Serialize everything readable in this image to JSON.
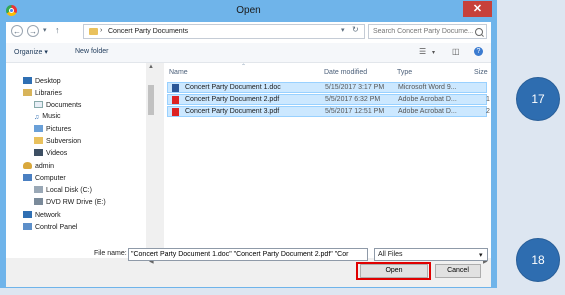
{
  "window": {
    "title": "Open",
    "close_glyph": "✕"
  },
  "address": {
    "path": "Concert Party Documents",
    "search_placeholder": "Search Concert Party Docume..."
  },
  "toolbar": {
    "organize_label": "Organize ▾",
    "new_folder_label": "New folder"
  },
  "nav": {
    "items": [
      {
        "label": "Desktop",
        "icon": "desktop-icon"
      },
      {
        "label": "Libraries",
        "icon": "library-icon"
      },
      {
        "label": "Documents",
        "icon": "documents-icon"
      },
      {
        "label": "Music",
        "icon": "music-icon"
      },
      {
        "label": "Pictures",
        "icon": "pictures-icon"
      },
      {
        "label": "Subversion",
        "icon": "folder-icon"
      },
      {
        "label": "Videos",
        "icon": "videos-icon"
      },
      {
        "label": "admin",
        "icon": "user-icon"
      },
      {
        "label": "Computer",
        "icon": "computer-icon"
      },
      {
        "label": "Local Disk (C:)",
        "icon": "drive-icon"
      },
      {
        "label": "DVD RW Drive (E:)",
        "icon": "dvd-icon"
      },
      {
        "label": "Network",
        "icon": "network-icon"
      },
      {
        "label": "Control Panel",
        "icon": "control-panel-icon"
      }
    ]
  },
  "columns": {
    "name": "Name",
    "date": "Date modified",
    "type": "Type",
    "size": "Size"
  },
  "files": [
    {
      "name": "Concert Party Document 1.doc",
      "date": "5/15/2017 3:17 PM",
      "type": "Microsoft Word 9...",
      "size": "",
      "icon": "word-doc-icon"
    },
    {
      "name": "Concert Party Document 2.pdf",
      "date": "5/5/2017 6:32 PM",
      "type": "Adobe Acrobat D...",
      "size": "1",
      "icon": "pdf-icon"
    },
    {
      "name": "Concert Party Document 3.pdf",
      "date": "5/5/2017 12:51 PM",
      "type": "Adobe Acrobat D...",
      "size": "2",
      "icon": "pdf-icon"
    }
  ],
  "footer": {
    "file_name_label": "File name:",
    "file_name_value": "\"Concert Party Document 1.doc\" \"Concert Party Document 2.pdf\" \"Cor",
    "file_type": "All Files",
    "open_label": "Open",
    "cancel_label": "Cancel"
  },
  "annotations": {
    "step_a": "17",
    "step_b": "18"
  },
  "colors": {
    "title_bar": "#6fb4ea",
    "selection": "#cce8ff",
    "close": "#c7413a",
    "callout": "#2e6db0",
    "highlight": "#e00000"
  }
}
